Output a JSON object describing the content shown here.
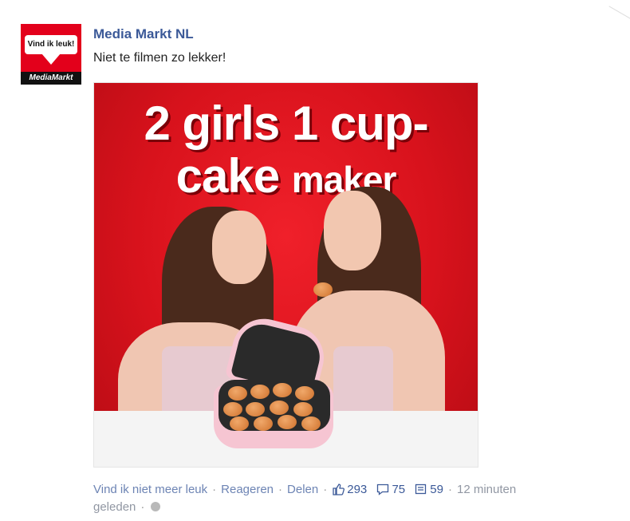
{
  "post": {
    "author": "Media Markt NL",
    "message": "Niet te filmen zo lekker!",
    "avatar": {
      "badge_text": "Vind ik leuk!",
      "logo_text": "MediaMarkt"
    },
    "image": {
      "headline_line1": "2 girls 1 cup-",
      "headline_line2_big": "cake",
      "headline_line2_small": "maker",
      "background_color": "#d8121c"
    }
  },
  "actions": {
    "unlike": "Vind ik niet meer leuk",
    "comment": "Reageren",
    "share": "Delen",
    "separator": "·",
    "likes_count": "293",
    "comments_count": "75",
    "shares_count": "59",
    "timestamp_part1": "12 minuten",
    "timestamp_part2": "geleden",
    "icons": [
      "thumbs-up-icon",
      "comment-bubble-icon",
      "share-icon",
      "globe-icon"
    ]
  },
  "colors": {
    "link": "#3b5998",
    "action_link": "#6d84b4",
    "muted": "#7f7f7f",
    "brand_red": "#e3001b"
  }
}
